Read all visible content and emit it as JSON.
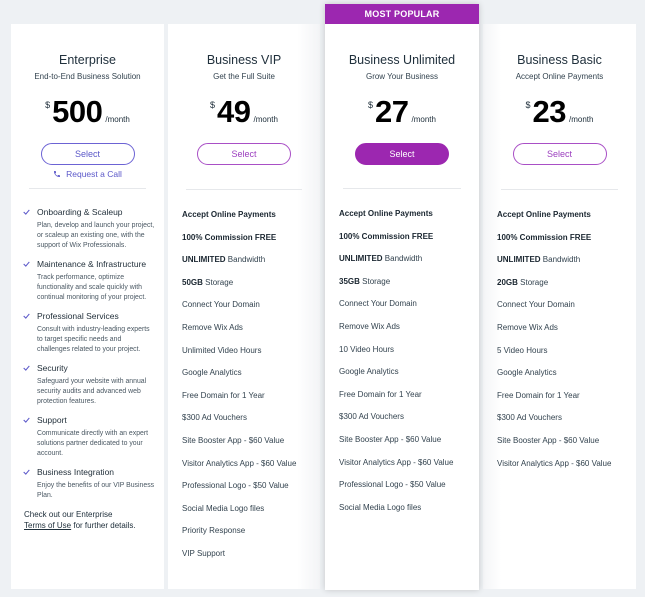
{
  "accent_colors": {
    "brand_purple": "#9c27b0",
    "enterprise_blue": "#5b58c9",
    "background": "#eef1f4"
  },
  "enterprise": {
    "title": "Enterprise",
    "subtitle": "End-to-End Business Solution",
    "currency": "$",
    "amount": "500",
    "period": "/month",
    "select_label": "Select",
    "call_label": "Request a Call",
    "call_icon": "phone-icon",
    "check_icon": "checkmark-icon",
    "features": [
      {
        "title": "Onboarding & Scaleup",
        "desc": "Plan, develop and launch your project, or scaleup an existing one, with the support of Wix Professionals."
      },
      {
        "title": "Maintenance & Infrastructure",
        "desc": "Track performance, optimize functionality and scale quickly with continual monitoring of your project."
      },
      {
        "title": "Professional Services",
        "desc": "Consult with industry-leading experts to target specific needs and challenges related to your project."
      },
      {
        "title": "Security",
        "desc": "Safeguard your website with annual security audits and advanced web protection features."
      },
      {
        "title": "Support",
        "desc": "Communicate directly with an expert solutions partner dedicated to your account."
      },
      {
        "title": "Business Integration",
        "desc": "Enjoy the benefits of our VIP Business Plan."
      }
    ],
    "footer_prefix": "Check out our Enterprise",
    "footer_link": "Terms of Use",
    "footer_suffix": " for further details."
  },
  "vip": {
    "title": "Business VIP",
    "subtitle": "Get the Full Suite",
    "currency": "$",
    "amount": "49",
    "period": "/month",
    "select_label": "Select",
    "features": [
      {
        "bold": "Accept Online Payments",
        "text": ""
      },
      {
        "bold": "100% Commission FREE",
        "text": ""
      },
      {
        "bold": "UNLIMITED",
        "text": " Bandwidth"
      },
      {
        "bold": "50GB",
        "text": " Storage"
      },
      {
        "bold": "",
        "text": "Connect Your Domain"
      },
      {
        "bold": "",
        "text": "Remove Wix Ads"
      },
      {
        "bold": "",
        "text": "Unlimited Video Hours"
      },
      {
        "bold": "",
        "text": "Google Analytics"
      },
      {
        "bold": "",
        "text": "Free Domain for 1 Year"
      },
      {
        "bold": "",
        "text": "$300 Ad Vouchers"
      },
      {
        "bold": "",
        "text": "Site Booster App - $60 Value"
      },
      {
        "bold": "",
        "text": "Visitor Analytics App - $60 Value"
      },
      {
        "bold": "",
        "text": "Professional Logo - $50 Value"
      },
      {
        "bold": "",
        "text": "Social Media Logo files"
      },
      {
        "bold": "",
        "text": "Priority Response"
      },
      {
        "bold": "",
        "text": "VIP Support"
      }
    ]
  },
  "unlimited": {
    "badge": "MOST POPULAR",
    "title": "Business Unlimited",
    "subtitle": "Grow Your Business",
    "currency": "$",
    "amount": "27",
    "period": "/month",
    "select_label": "Select",
    "features": [
      {
        "bold": "Accept Online Payments",
        "text": ""
      },
      {
        "bold": "100% Commission FREE",
        "text": ""
      },
      {
        "bold": "UNLIMITED",
        "text": " Bandwidth"
      },
      {
        "bold": "35GB",
        "text": " Storage"
      },
      {
        "bold": "",
        "text": "Connect Your Domain"
      },
      {
        "bold": "",
        "text": "Remove Wix Ads"
      },
      {
        "bold": "",
        "text": "10 Video Hours"
      },
      {
        "bold": "",
        "text": "Google Analytics"
      },
      {
        "bold": "",
        "text": "Free Domain for 1 Year"
      },
      {
        "bold": "",
        "text": "$300 Ad Vouchers"
      },
      {
        "bold": "",
        "text": "Site Booster App - $60 Value"
      },
      {
        "bold": "",
        "text": "Visitor Analytics App - $60 Value"
      },
      {
        "bold": "",
        "text": "Professional Logo - $50 Value"
      },
      {
        "bold": "",
        "text": "Social Media Logo files"
      }
    ]
  },
  "basic": {
    "title": "Business Basic",
    "subtitle": "Accept Online Payments",
    "currency": "$",
    "amount": "23",
    "period": "/month",
    "select_label": "Select",
    "features": [
      {
        "bold": "Accept Online Payments",
        "text": ""
      },
      {
        "bold": "100% Commission FREE",
        "text": ""
      },
      {
        "bold": "UNLIMITED",
        "text": " Bandwidth"
      },
      {
        "bold": "20GB",
        "text": " Storage"
      },
      {
        "bold": "",
        "text": "Connect Your Domain"
      },
      {
        "bold": "",
        "text": "Remove Wix Ads"
      },
      {
        "bold": "",
        "text": "5 Video Hours"
      },
      {
        "bold": "",
        "text": "Google Analytics"
      },
      {
        "bold": "",
        "text": "Free Domain for 1 Year"
      },
      {
        "bold": "",
        "text": "$300 Ad Vouchers"
      },
      {
        "bold": "",
        "text": "Site Booster App - $60 Value"
      },
      {
        "bold": "",
        "text": "Visitor Analytics App - $60 Value"
      }
    ]
  }
}
